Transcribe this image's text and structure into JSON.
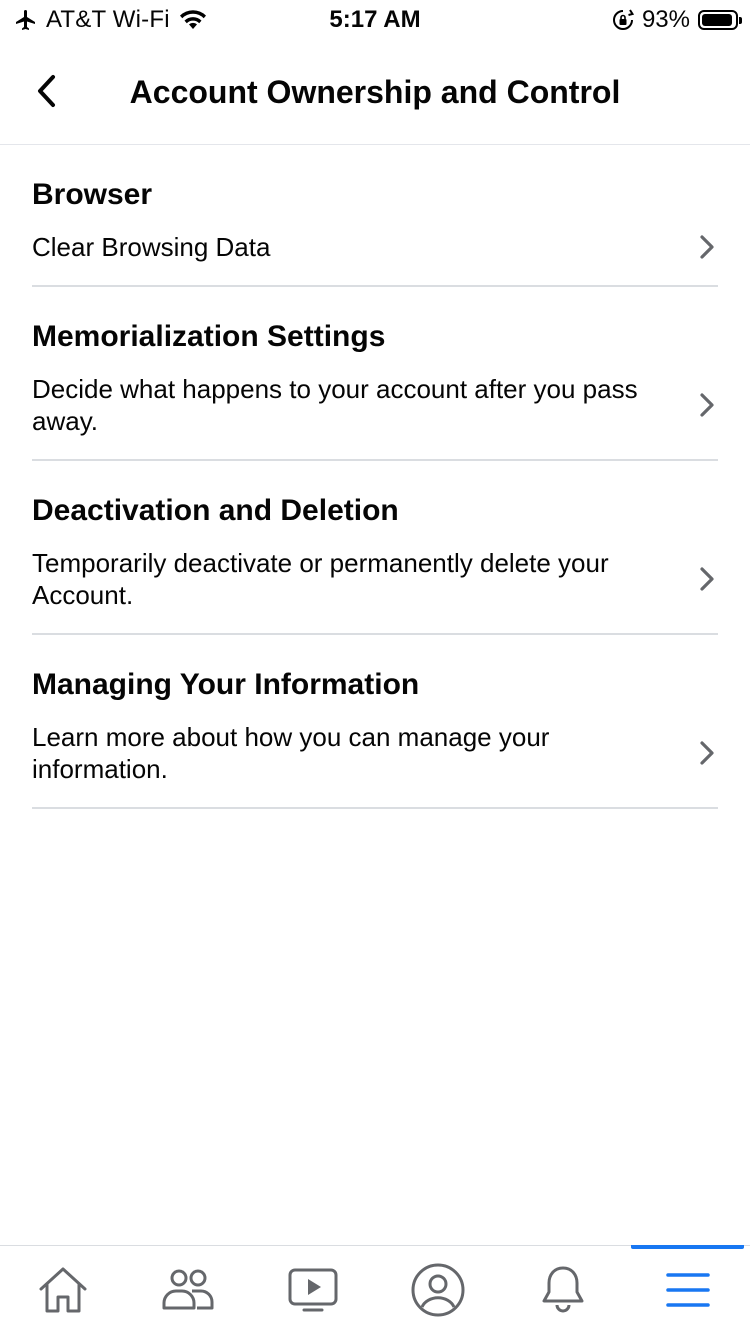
{
  "status_bar": {
    "carrier": "AT&T Wi-Fi",
    "time": "5:17 AM",
    "battery": "93%",
    "battery_level": 0.93
  },
  "header": {
    "title": "Account Ownership and Control",
    "back_icon": "chevron-left-icon"
  },
  "sections": [
    {
      "title": "Browser",
      "description": "Clear Browsing Data"
    },
    {
      "title": "Memorialization Settings",
      "description": "Decide what happens to your account after you pass away."
    },
    {
      "title": "Deactivation and Deletion",
      "description": "Temporarily deactivate or permanently delete your Account."
    },
    {
      "title": "Managing Your Information",
      "description": "Learn more about how you can manage your information."
    }
  ],
  "tab_bar": {
    "tabs": [
      {
        "name": "home",
        "icon": "home-icon"
      },
      {
        "name": "friends",
        "icon": "friends-icon"
      },
      {
        "name": "watch",
        "icon": "video-icon"
      },
      {
        "name": "profile",
        "icon": "profile-icon"
      },
      {
        "name": "notifications",
        "icon": "bell-icon"
      },
      {
        "name": "menu",
        "icon": "menu-icon",
        "active": true
      }
    ]
  },
  "colors": {
    "accent": "#1877f2",
    "chevron": "#65676b",
    "divider": "#dadde1",
    "icon": "#65676b"
  }
}
